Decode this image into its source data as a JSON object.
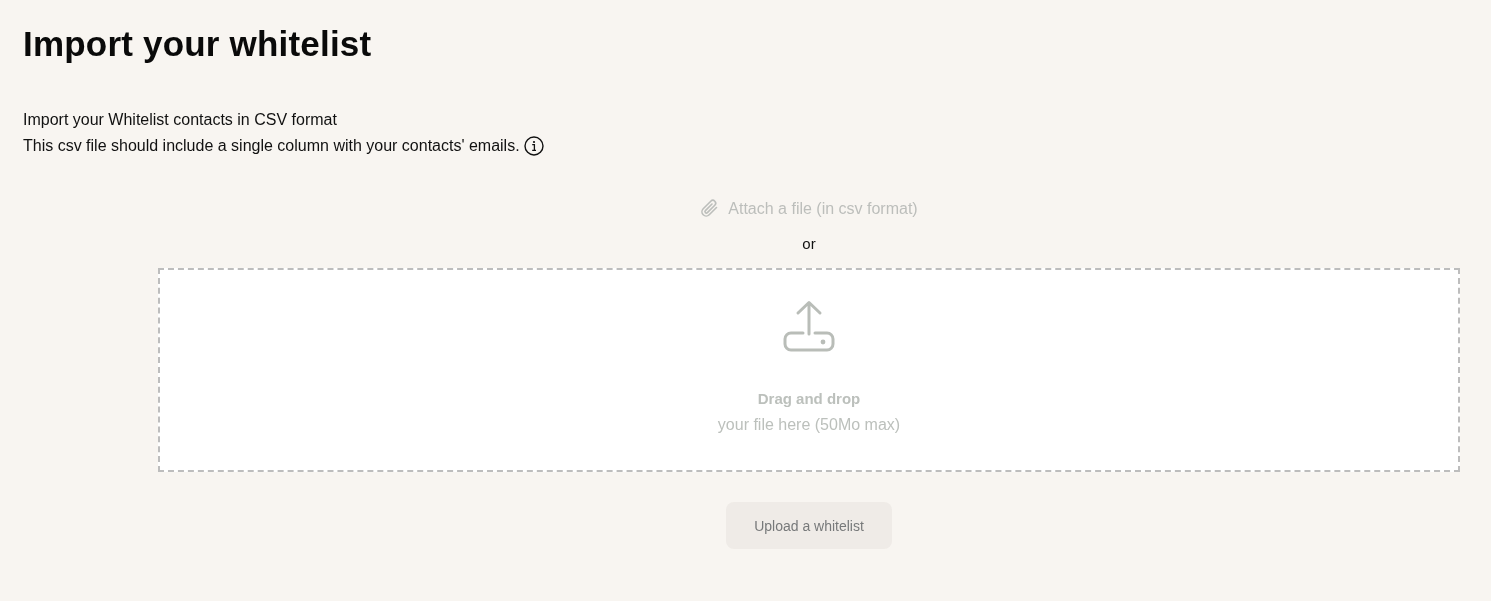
{
  "title": "Import your whitelist",
  "description": [
    "Import your Whitelist contacts in CSV format",
    "This csv file should include a single column with your contacts' emails."
  ],
  "attach_link": {
    "label": "Attach a file (in csv format)",
    "disabled": true
  },
  "separator": "or",
  "drop_zone": {
    "title": "Drag and drop",
    "hint": "your file here (50Mo max)"
  },
  "upload_button": {
    "label": "Upload a whitelist",
    "disabled": true
  }
}
